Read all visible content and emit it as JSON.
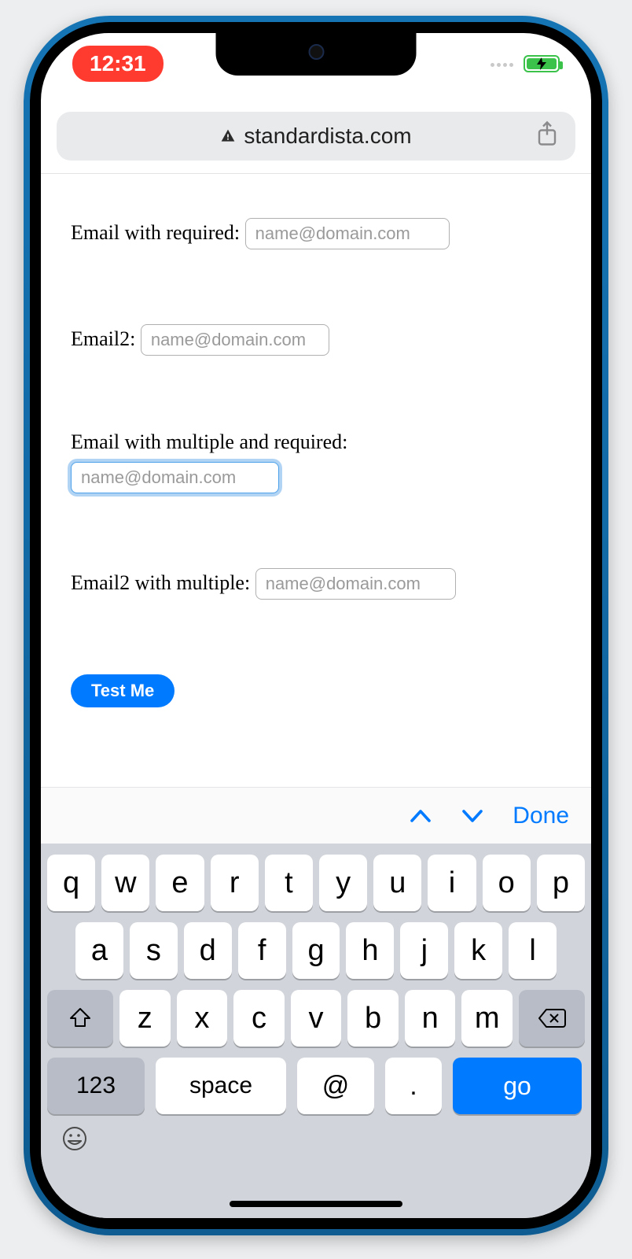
{
  "status": {
    "time": "12:31"
  },
  "browser": {
    "domain": "standardista.com"
  },
  "form": {
    "field1": {
      "label": "Email with required:",
      "placeholder": "name@domain.com",
      "value": ""
    },
    "field2": {
      "label": "Email2:",
      "placeholder": "name@domain.com",
      "value": ""
    },
    "field3": {
      "label": "Email with multiple and required:",
      "placeholder": "name@domain.com",
      "value": ""
    },
    "field4": {
      "label": "Email2 with multiple:",
      "placeholder": "name@domain.com",
      "value": ""
    },
    "submit_label": "Test Me"
  },
  "keyboard": {
    "accessory": {
      "done": "Done"
    },
    "row1": [
      "q",
      "w",
      "e",
      "r",
      "t",
      "y",
      "u",
      "i",
      "o",
      "p"
    ],
    "row2": [
      "a",
      "s",
      "d",
      "f",
      "g",
      "h",
      "j",
      "k",
      "l"
    ],
    "row3": [
      "z",
      "x",
      "c",
      "v",
      "b",
      "n",
      "m"
    ],
    "numbers_key": "123",
    "space_key": "space",
    "at_key": "@",
    "dot_key": ".",
    "go_key": "go"
  }
}
